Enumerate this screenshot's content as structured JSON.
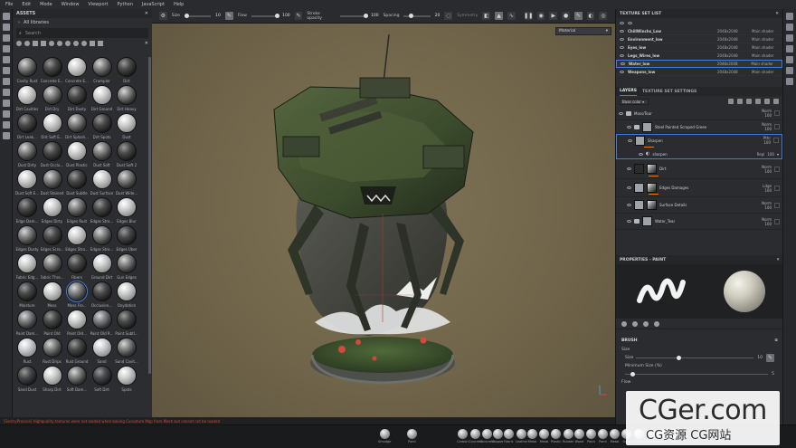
{
  "menu": [
    "File",
    "Edit",
    "Mode",
    "Window",
    "Viewport",
    "Python",
    "JavaScript",
    "Help"
  ],
  "assets": {
    "title": "ASSETS",
    "library": "All libraries",
    "search_placeholder": "Search",
    "items": [
      "Cavity Rust",
      "Concrete E...",
      "Concrete E...",
      "Crumpler",
      "Dirt",
      "Dirt Cavities",
      "Dirt Dry",
      "Dirt Dusty",
      "Dirt Ground",
      "Dirt Heavy",
      "Dirt Leak...",
      "Dirt Soft E...",
      "Dirt Splash...",
      "Dirt Spots",
      "Dust",
      "Dust Dirty",
      "Dust Occlu...",
      "Dust Plastic",
      "Dust Soft",
      "Dust Soft 2",
      "Dust Soft E...",
      "Dust Stained",
      "Dust Subtle",
      "Dust Surface",
      "Dust Wide...",
      "Edge Dam...",
      "Edges Dirty",
      "Edges Rust",
      "Edges Stro...",
      "Edges Blur",
      "Edges Dusty",
      "Edges Scra...",
      "Edges Stro...",
      "Edges Stro...",
      "Edges Uber",
      "Fabric Edg...",
      "Fabric Thre...",
      "Fibers",
      "Ground Dirt",
      "Gun Edges",
      "Moisture",
      "Moss",
      "Moss Fro...",
      "Occlusion...",
      "Oxydation",
      "Paint Dam...",
      "Paint Old",
      "Paint Old...",
      "Paint Old R...",
      "Paint Subtl...",
      "Rust",
      "Rust Drips",
      "Rust Ground",
      "Sand",
      "Sand Cavit...",
      "Sand Dust",
      "Sharp Dirt",
      "Soft Dam...",
      "Soft Dirt",
      "Spots"
    ]
  },
  "toolbar": {
    "size_label": "Size",
    "size_value": "10",
    "flow_label": "Flow",
    "flow_value": "100",
    "stroke_label": "Stroke opacity",
    "stroke_value": "100",
    "spacing_label": "Spacing",
    "spacing_value": "20",
    "symmetry_label": "Symmetry"
  },
  "viewport": {
    "material_mode": "Material"
  },
  "texture_sets": {
    "title": "TEXTURE SET LIST",
    "rows": [
      {
        "name": "ChillWinchs_Low",
        "res": "2048x2048",
        "shader": "Main shader"
      },
      {
        "name": "Environment_low",
        "res": "2048x2048",
        "shader": "Main shader"
      },
      {
        "name": "Eyes_low",
        "res": "2048x2048",
        "shader": "Main shader"
      },
      {
        "name": "Legs_Wires_low",
        "res": "2048x2048",
        "shader": "Main shader"
      },
      {
        "name": "Water_low",
        "res": "2048x2048",
        "shader": "Main shader"
      },
      {
        "name": "Weapons_low",
        "res": "2048x2048",
        "shader": "Main shader"
      }
    ]
  },
  "layers": {
    "tab_layers": "LAYERS",
    "tab_settings": "TEXTURE SET SETTINGS",
    "channel": "Base color",
    "rows": [
      {
        "name": "Moss/Tear",
        "blend": "Norm",
        "opacity": "100"
      },
      {
        "name": "Steel Painted Scraped Green",
        "blend": "Norm",
        "opacity": "100"
      },
      {
        "name": "Sharpen",
        "blend": "Pthr",
        "opacity": "100"
      },
      {
        "name": "sharpen",
        "blend": "Repl",
        "opacity": "100"
      },
      {
        "name": "Dirt",
        "blend": "Norm",
        "opacity": "100"
      },
      {
        "name": "Edges Damages",
        "blend": "Ldge",
        "opacity": "100"
      },
      {
        "name": "Surface Details",
        "blend": "Norm",
        "opacity": "100"
      },
      {
        "name": "Water_Tear",
        "blend": "Norm",
        "opacity": "100"
      }
    ]
  },
  "properties": {
    "title": "PROPERTIES - PAINT",
    "section": "BRUSH",
    "size_group": "Size",
    "size_label": "Size",
    "size_value": "10",
    "min_size_label": "Minimum Size (%)",
    "min_size_value": "5",
    "flow_label": "Flow"
  },
  "status": "[SentryProcess] Highquality textures were not loaded when baking Curvature Map from Mesh but cannot not be loaded",
  "shelf": [
    "Smudge",
    "Paint",
    "Carbon",
    "Concrete",
    "Concrete",
    "Copper",
    "Fabric",
    "Leather",
    "Metal",
    "Metal",
    "Plastic",
    "Rubber",
    "Wood",
    "Paint",
    "Paint",
    "Metal",
    "Gold",
    "Chrome",
    "Chrome",
    "Steel",
    "Steel"
  ],
  "watermark": {
    "big": "CGer.com",
    "small": "CG资源 CG网站"
  },
  "colors": {
    "accent": "#3e7de0",
    "mask_orange": "#e07a1f"
  }
}
